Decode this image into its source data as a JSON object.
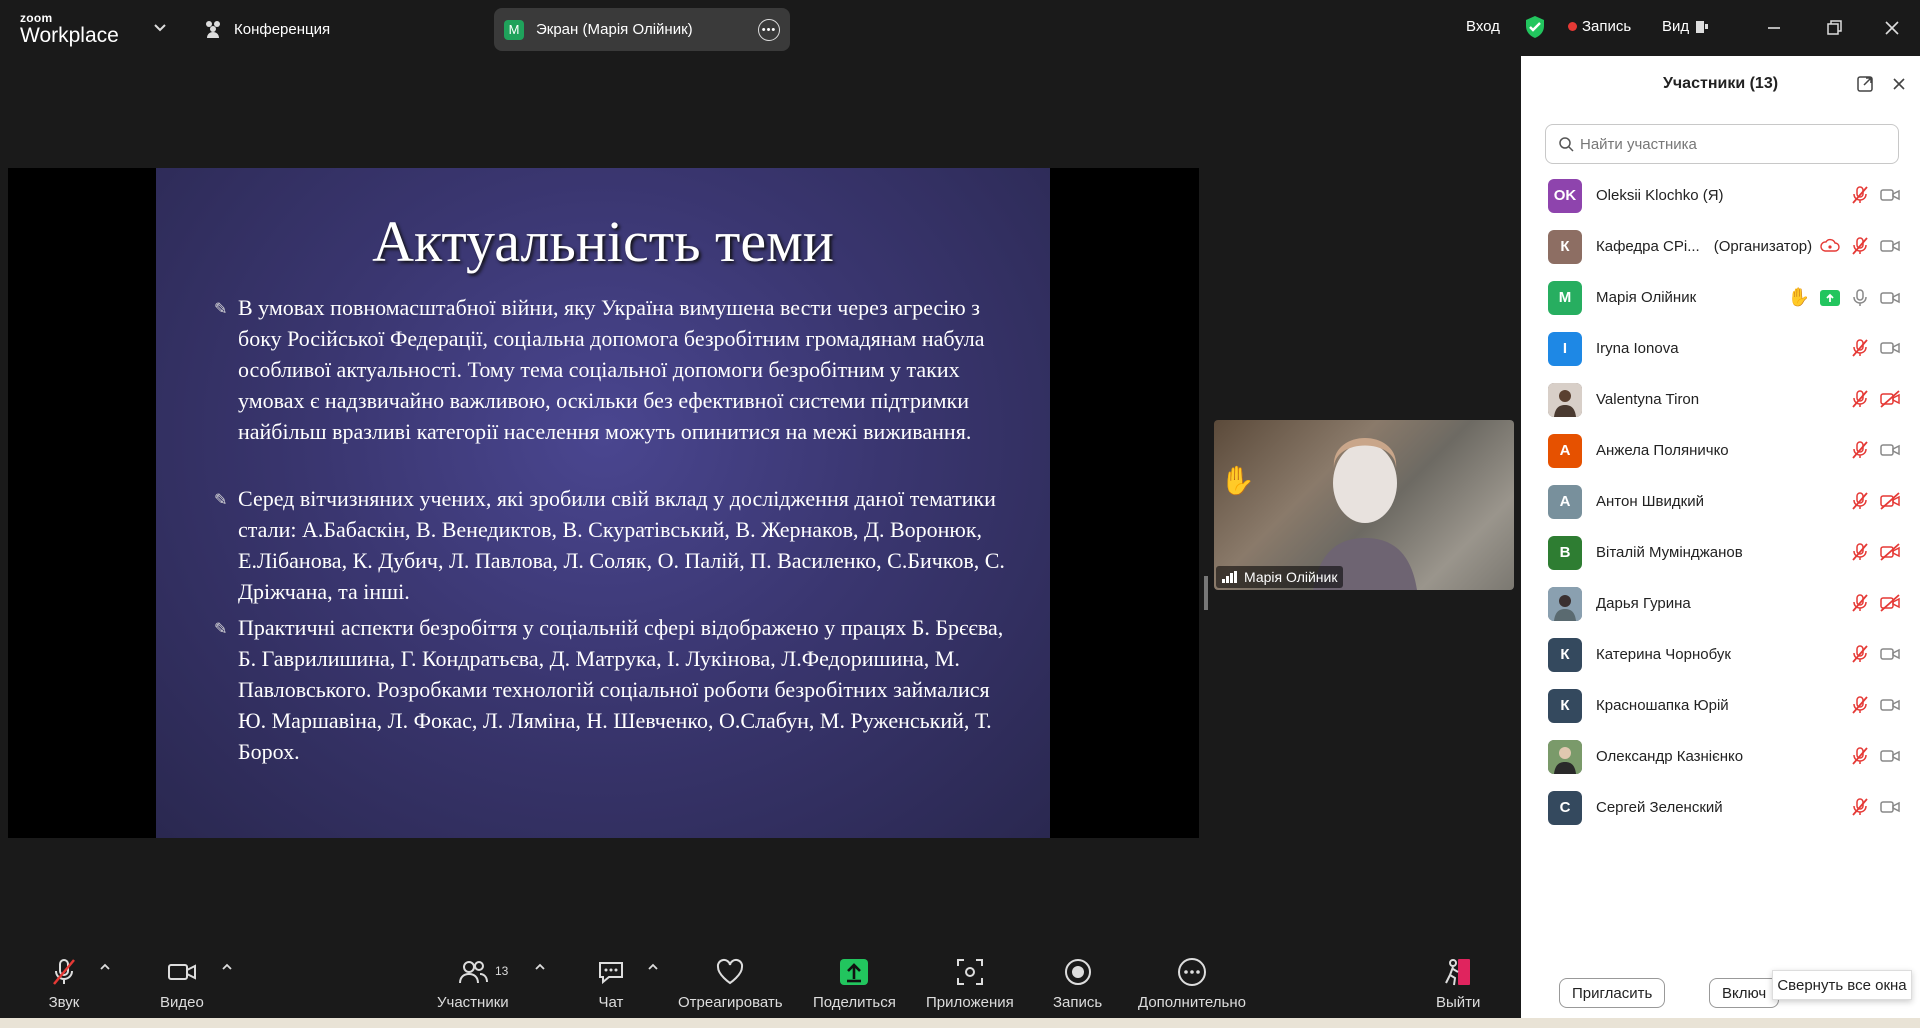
{
  "app": {
    "logo_top": "zoom",
    "logo_bottom": "Workplace",
    "meeting_label": "Конференция"
  },
  "screen_tab": {
    "badge": "M",
    "title": "Экран (Марія Олійник)"
  },
  "top_right": {
    "login": "Вход",
    "record": "Запись",
    "view": "Вид"
  },
  "slide": {
    "title": "Актуальність теми",
    "bullets": [
      "В умовах повномасштабної війни, яку Україна вимушена вести через агресію з боку Російської Федерації, соціальна допомога безробітним громадянам набула особливої актуальності. Тому тема соціальної допомоги безробітним у таких умовах є надзвичайно важливою, оскільки без ефективної системи підтримки найбільш вразливі категорії населення можуть опинитися на межі виживання.",
      "Серед вітчизняних учених, які зробили свій вклад у дослідження даної тематики стали: А.Бабаскін, В. Венедиктов, В. Скуратівський, В. Жернаков, Д. Воронюк, Е.Лібанова, К. Дубич, Л. Павлова, Л. Соляк, О. Палій, П. Василенко, С.Бичков, С. Дріжчана, та інші.",
      "Практичні аспекти безробіття у соціальній сфері відображено у працях Б. Брєєва, Б. Гаврилишина, Г. Кондратьєва, Д. Матрука, І. Лукінова, Л.Федоришина, М. Павловського. Розробками технологій соціальної роботи безробітних займалися Ю. Маршавіна, Л. Фокас, Л. Ляміна, Н. Шевченко, О.Слабун, М. Руженський, Т. Борох."
    ]
  },
  "video_tile": {
    "name": "Марія Олійник"
  },
  "participants": {
    "title": "Участники (13)",
    "search_placeholder": "Найти участника",
    "list": [
      {
        "initials": "OK",
        "name": "Oleksii Klochko (Я)",
        "role": "",
        "color": "#8e44ad"
      },
      {
        "initials": "К",
        "name": "Кафедра СРі...",
        "role": "(Организатор)",
        "color": "#8d6e63"
      },
      {
        "initials": "M",
        "name": "Марія Олійник",
        "role": "",
        "color": "#27ae60"
      },
      {
        "initials": "I",
        "name": "Iryna Ionova",
        "role": "",
        "color": "#1e88e5"
      },
      {
        "initials": "",
        "name": "Valentyna Tiron",
        "role": "",
        "color": "#6d5d55"
      },
      {
        "initials": "А",
        "name": "Анжела Поляничко",
        "role": "",
        "color": "#e65100"
      },
      {
        "initials": "А",
        "name": "Антон Швидкий",
        "role": "",
        "color": "#78909c"
      },
      {
        "initials": "В",
        "name": "Віталій Мумінджанов",
        "role": "",
        "color": "#2e7d32"
      },
      {
        "initials": "",
        "name": "Дарья Гурина",
        "role": "",
        "color": "#5d6d7e"
      },
      {
        "initials": "К",
        "name": "Катерина Чорнобук",
        "role": "",
        "color": "#34495e"
      },
      {
        "initials": "К",
        "name": "Красношапка Юрій",
        "role": "",
        "color": "#34495e"
      },
      {
        "initials": "",
        "name": "Олександр Казнієнко",
        "role": "",
        "color": "#556b4f"
      },
      {
        "initials": "С",
        "name": "Сергей Зеленский",
        "role": "",
        "color": "#34495e"
      }
    ],
    "invite": "Пригласить",
    "unmute_all": "Включ",
    "tooltip": "Свернуть все окна"
  },
  "toolbar": {
    "audio": "Звук",
    "video": "Видео",
    "participants": "Участники",
    "participants_count": "13",
    "chat": "Чат",
    "react": "Отреагировать",
    "share": "Поделиться",
    "apps": "Приложения",
    "record": "Запись",
    "more": "Дополнительно",
    "leave": "Выйти"
  },
  "colors": {
    "accent_green": "#22c55e",
    "record_red": "#e53935",
    "danger": "#e0245e"
  }
}
